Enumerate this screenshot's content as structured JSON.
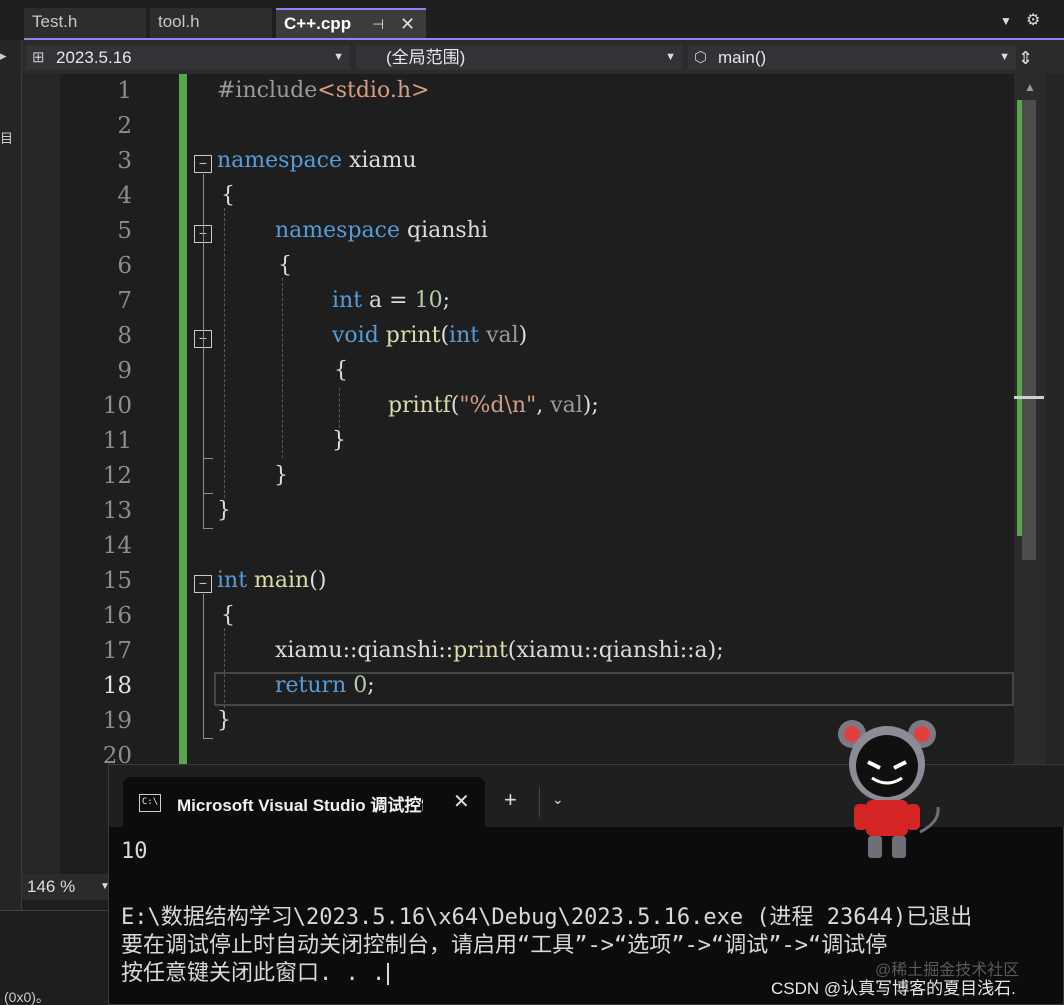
{
  "tabs": [
    {
      "label": "Test.h",
      "active": false
    },
    {
      "label": "tool.h",
      "active": false
    },
    {
      "label": "C++.cpp",
      "active": true
    }
  ],
  "tab_icons": {
    "pin": "pin-icon",
    "close": "close-icon",
    "overflow": "chevron-down-icon",
    "settings": "gear-icon"
  },
  "navbar": {
    "project": "2023.5.16",
    "scope": "(全局范围)",
    "member": "main()"
  },
  "editor": {
    "line_numbers": [
      "1",
      "2",
      "3",
      "4",
      "5",
      "6",
      "7",
      "8",
      "9",
      "10",
      "11",
      "12",
      "13",
      "14",
      "15",
      "16",
      "17",
      "18",
      "19",
      "20"
    ],
    "current_line": "18",
    "lines": {
      "l1_a": "#include",
      "l1_b": "<stdio.h>",
      "l3_kw": "namespace",
      "l3_name": " xiamu",
      "l4": "{",
      "l5_kw": "namespace",
      "l5_name": " qianshi",
      "l6": "{",
      "l7_kw": "int",
      "l7_rest": " a = ",
      "l7_num": "10",
      "l7_end": ";",
      "l8_kw": "void",
      "l8_fn": " print",
      "l8_p1": "(",
      "l8_kw2": "int",
      "l8_par": " val",
      "l8_p2": ")",
      "l9": "{",
      "l10_fn": "printf",
      "l10_p1": "(",
      "l10_str": "\"%d\\n\"",
      "l10_rest": ", ",
      "l10_par": "val",
      "l10_end": ");",
      "l11": "}",
      "l12": "}",
      "l13": "}",
      "l15_kw": "int",
      "l15_fn": " main",
      "l15_end": "()",
      "l16": "{",
      "l17_a": "xiamu::qianshi::",
      "l17_fn": "print",
      "l17_b": "(xiamu::qianshi::a);",
      "l18_kw": "return",
      "l18_num": " 0",
      "l18_end": ";",
      "l19": "}"
    }
  },
  "zoom": "146 %",
  "status_fragment": "(0x0)。",
  "terminal": {
    "tab_title": "Microsoft Visual Studio 调试控制台",
    "output": [
      "10",
      "",
      "E:\\数据结构学习\\2023.5.16\\x64\\Debug\\2023.5.16.exe (进程 23644)已退出",
      "要在调试停止时自动关闭控制台，请启用“工具”->“选项”->“调试”->“调试停",
      "按任意键关闭此窗口. . ."
    ]
  },
  "watermarks": {
    "juejin": "@稀土掘金技术社区",
    "csdn": "CSDN @认真写博客的夏目浅石."
  }
}
